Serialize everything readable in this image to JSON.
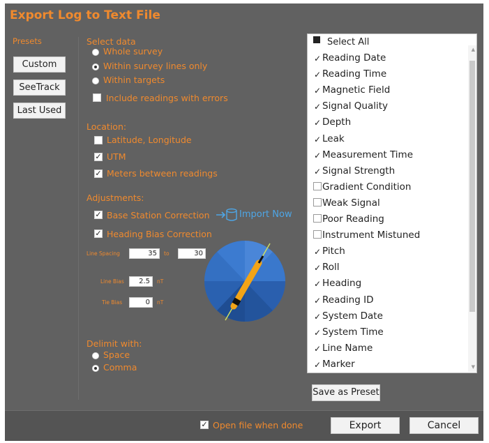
{
  "title": "Export Log to Text File",
  "presets": {
    "label": "Presets",
    "buttons": [
      "Custom",
      "SeeTrack",
      "Last Used"
    ]
  },
  "select_data": {
    "label": "Select data",
    "options": [
      "Whole survey",
      "Within survey lines only",
      "Within targets"
    ],
    "selected": "Within survey lines only",
    "include_errors": {
      "label": "Include readings with errors",
      "checked": false
    }
  },
  "location": {
    "label": "Location:",
    "items": [
      {
        "label": "Latitude, Longitude",
        "checked": false
      },
      {
        "label": "UTM",
        "checked": true
      },
      {
        "label": "Meters between readings",
        "checked": true
      }
    ]
  },
  "adjustments": {
    "label": "Adjustments:",
    "base_station": {
      "label": "Base Station Correction",
      "checked": true
    },
    "import_now": "Import Now",
    "heading_bias": {
      "label": "Heading Bias Correction",
      "checked": true
    },
    "line_spacing": {
      "label": "Line Spacing",
      "from": "35",
      "to": "30",
      "to_label": "to"
    },
    "line_bias": {
      "label": "Line Bias",
      "value": "2.5",
      "unit": "nT"
    },
    "tie_bias": {
      "label": "Tie Bias",
      "value": "0",
      "unit": "nT"
    }
  },
  "delimit": {
    "label": "Delimit with:",
    "options": [
      "Space",
      "Comma"
    ],
    "selected": "Comma"
  },
  "fields": {
    "select_all": {
      "label": "Select All",
      "checked": "partial"
    },
    "items": [
      {
        "label": "Reading Date",
        "checked": true
      },
      {
        "label": "Reading Time",
        "checked": true
      },
      {
        "label": "Magnetic Field",
        "checked": true
      },
      {
        "label": "Signal Quality",
        "checked": true
      },
      {
        "label": "Depth",
        "checked": true
      },
      {
        "label": "Leak",
        "checked": true
      },
      {
        "label": "Measurement Time",
        "checked": true
      },
      {
        "label": "Signal Strength",
        "checked": true
      },
      {
        "label": "Gradient Condition",
        "checked": false
      },
      {
        "label": "Weak Signal",
        "checked": false
      },
      {
        "label": "Poor Reading",
        "checked": false
      },
      {
        "label": "Instrument Mistuned",
        "checked": false
      },
      {
        "label": "Pitch",
        "checked": true
      },
      {
        "label": "Roll",
        "checked": true
      },
      {
        "label": "Heading",
        "checked": true
      },
      {
        "label": "Reading ID",
        "checked": true
      },
      {
        "label": "System Date",
        "checked": true
      },
      {
        "label": "System Time",
        "checked": true
      },
      {
        "label": "Line Name",
        "checked": true
      },
      {
        "label": "Marker",
        "checked": true
      }
    ]
  },
  "save_preset": "Save as Preset",
  "footer": {
    "open_when_done": {
      "label": "Open file when done",
      "checked": true
    },
    "export": "Export",
    "cancel": "Cancel"
  },
  "colors": {
    "accent": "#f08a2e",
    "background": "#616161",
    "link": "#4ea6e6"
  }
}
